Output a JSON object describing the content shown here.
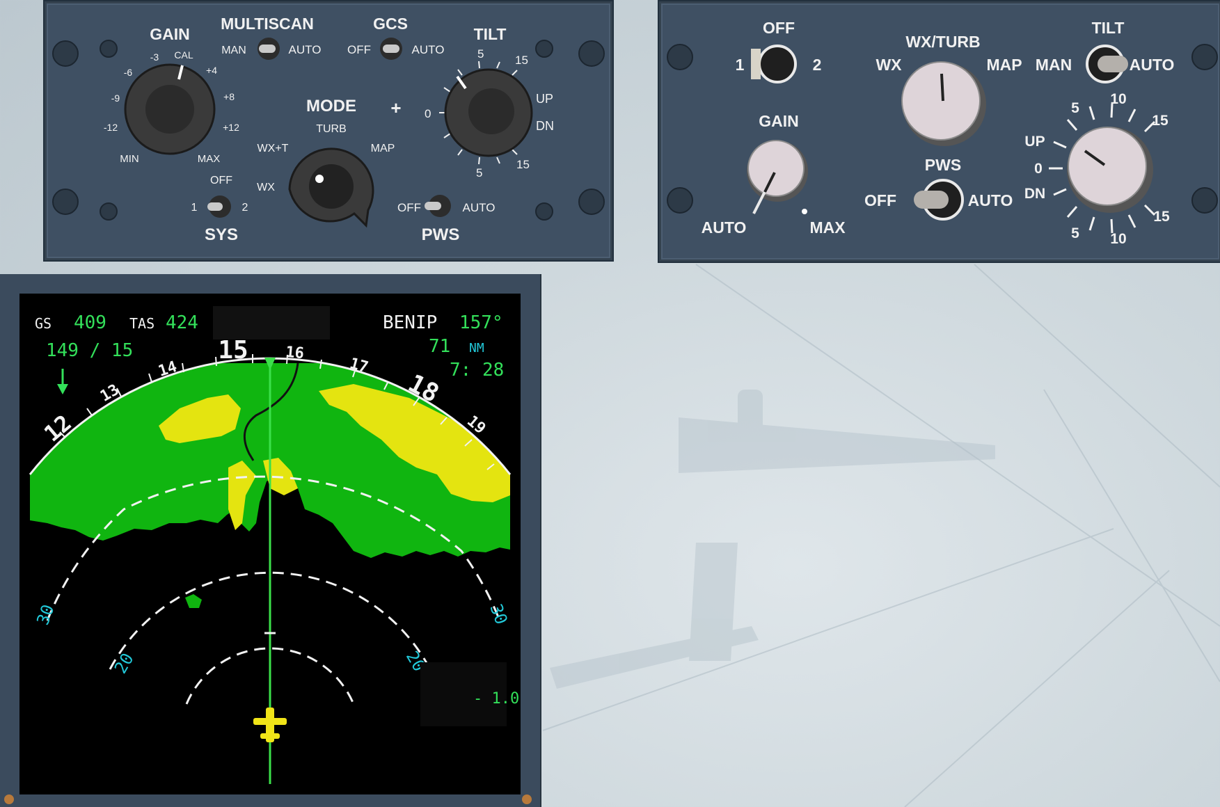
{
  "left_panel": {
    "gain": {
      "label": "GAIN",
      "scale": [
        "-3",
        "CAL",
        "+4",
        "-6",
        "+8",
        "-9",
        "+12",
        "-12",
        "MIN",
        "MAX"
      ]
    },
    "multiscan": {
      "label": "MULTISCAN",
      "left": "MAN",
      "right": "AUTO"
    },
    "gcs": {
      "label": "GCS",
      "left": "OFF",
      "right": "AUTO"
    },
    "tilt": {
      "label": "TILT",
      "top_left": "5",
      "top_right": "15",
      "zero": "0",
      "up": "UP",
      "dn": "DN",
      "bottom_left": "5",
      "bottom_right": "15"
    },
    "mode": {
      "label": "MODE",
      "plus": "+",
      "turb": "TURB",
      "wxt": "WX+T",
      "map": "MAP",
      "wx": "WX"
    },
    "sys": {
      "label": "SYS",
      "off": "OFF",
      "one": "1",
      "two": "2"
    },
    "pws": {
      "label": "PWS",
      "left": "OFF",
      "right": "AUTO"
    }
  },
  "right_panel": {
    "sys": {
      "off": "OFF",
      "one": "1",
      "two": "2"
    },
    "wxturb": {
      "label": "WX/TURB",
      "left": "WX",
      "right": "MAP"
    },
    "tilt": {
      "label": "TILT",
      "man": "MAN",
      "auto": "AUTO",
      "ten_top": "10",
      "five_top": "5",
      "fifteen_top": "15",
      "up": "UP",
      "zero": "0",
      "dn": "DN",
      "fifteen_bottom": "15",
      "five_bottom": "5",
      "ten_bottom": "10"
    },
    "gain": {
      "label": "GAIN",
      "auto": "AUTO",
      "max": "MAX"
    },
    "pws": {
      "label": "PWS",
      "off": "OFF",
      "auto": "AUTO"
    }
  },
  "display": {
    "gs_label": "GS",
    "gs_value": "409",
    "tas_label": "TAS",
    "tas_value": "424",
    "wind": "149 / 15",
    "waypoint": "BENIP",
    "bearing": "157°",
    "distance": "71",
    "distance_unit": "NM",
    "eta": "7: 28",
    "tilt_readout": "- 1.0°",
    "compass": [
      "12",
      "13",
      "14",
      "15",
      "16",
      "17",
      "18",
      "19"
    ],
    "range_rings": [
      "30",
      "20",
      "20",
      "30"
    ],
    "colors": {
      "green_text": "#33e05a",
      "cyan_text": "#22c8d8",
      "wx_green": "#10b510",
      "wx_yellow": "#e4e410",
      "aircraft": "#f0e418"
    }
  }
}
